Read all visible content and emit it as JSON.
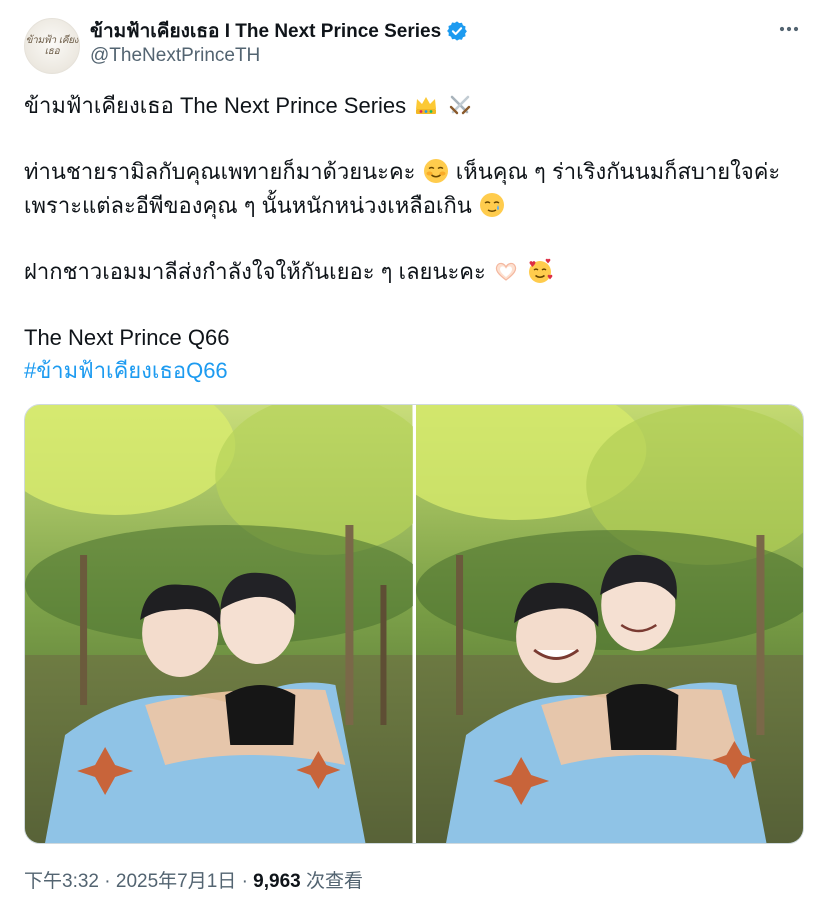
{
  "author": {
    "display_name": "ข้ามฟ้าเคียงเธอ I The Next Prince Series",
    "handle": "@TheNextPrinceTH",
    "avatar_logo": "ข้ามฟ้า เคียงเธอ"
  },
  "tweet": {
    "line1": "ข้ามฟ้าเคียงเธอ The Next Prince Series",
    "line2a": "ท่านชายรามิลกับคุณเพทายก็มาด้วยนะคะ",
    "line2b": "เห็นคุณ ๆ ร่าเริงกันนมก็สบายใจค่ะ",
    "line3": "เพราะแต่ละอีพีของคุณ ๆ นั้นหนักหน่วงเหลือเกิน",
    "line4": "ฝากชาวเอมมาลีส่งกำลังใจให้กันเยอะ ๆ เลยนะคะ",
    "line5": "The Next Prince Q66",
    "hashtag": "#ข้ามฟ้าเคียงเธอQ66"
  },
  "icons": {
    "verified": "verified-badge-icon",
    "more": "more-options-icon",
    "crown": "crown-emoji",
    "swords": "crossed-swords-emoji",
    "smile": "smiling-face-emoji",
    "tear": "smiling-face-with-tear-emoji",
    "heart_hands": "heart-hands-emoji",
    "hearts_face": "smiling-face-with-hearts-emoji"
  },
  "meta": {
    "time": "下午3:32",
    "date": "2025年7月1日",
    "sep": "·",
    "views": "9,963",
    "views_label": "次查看"
  },
  "colors": {
    "link": "#1d9bf0",
    "secondary": "#536471",
    "verified": "#1d9bf0"
  }
}
